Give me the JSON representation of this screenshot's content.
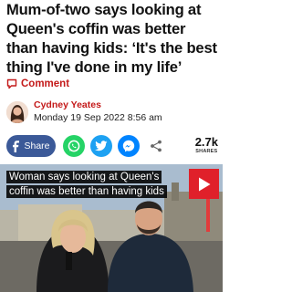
{
  "article": {
    "headline": "Mum-of-two says looking at Queen's coffin was better than having kids: ‘It's the best thing I've done in my life’",
    "comment_label": "Comment"
  },
  "author": {
    "name": "Cydney Yeates",
    "date": "Monday 19 Sep 2022 8:56 am"
  },
  "share": {
    "share_label": "Share",
    "count": "2.7k",
    "count_label": "SHARES",
    "icons": [
      "facebook-icon",
      "whatsapp-icon",
      "twitter-icon",
      "messenger-icon",
      "share-icon"
    ],
    "colors": {
      "facebook": "#3b5998",
      "whatsapp": "#25d366",
      "twitter": "#1da1f2",
      "messenger": "#0084ff"
    }
  },
  "video": {
    "caption": "Woman says looking at Queen's coffin was better than having kids",
    "play_color": "#e0202a"
  },
  "theme": {
    "accent": "#c41a1a"
  }
}
